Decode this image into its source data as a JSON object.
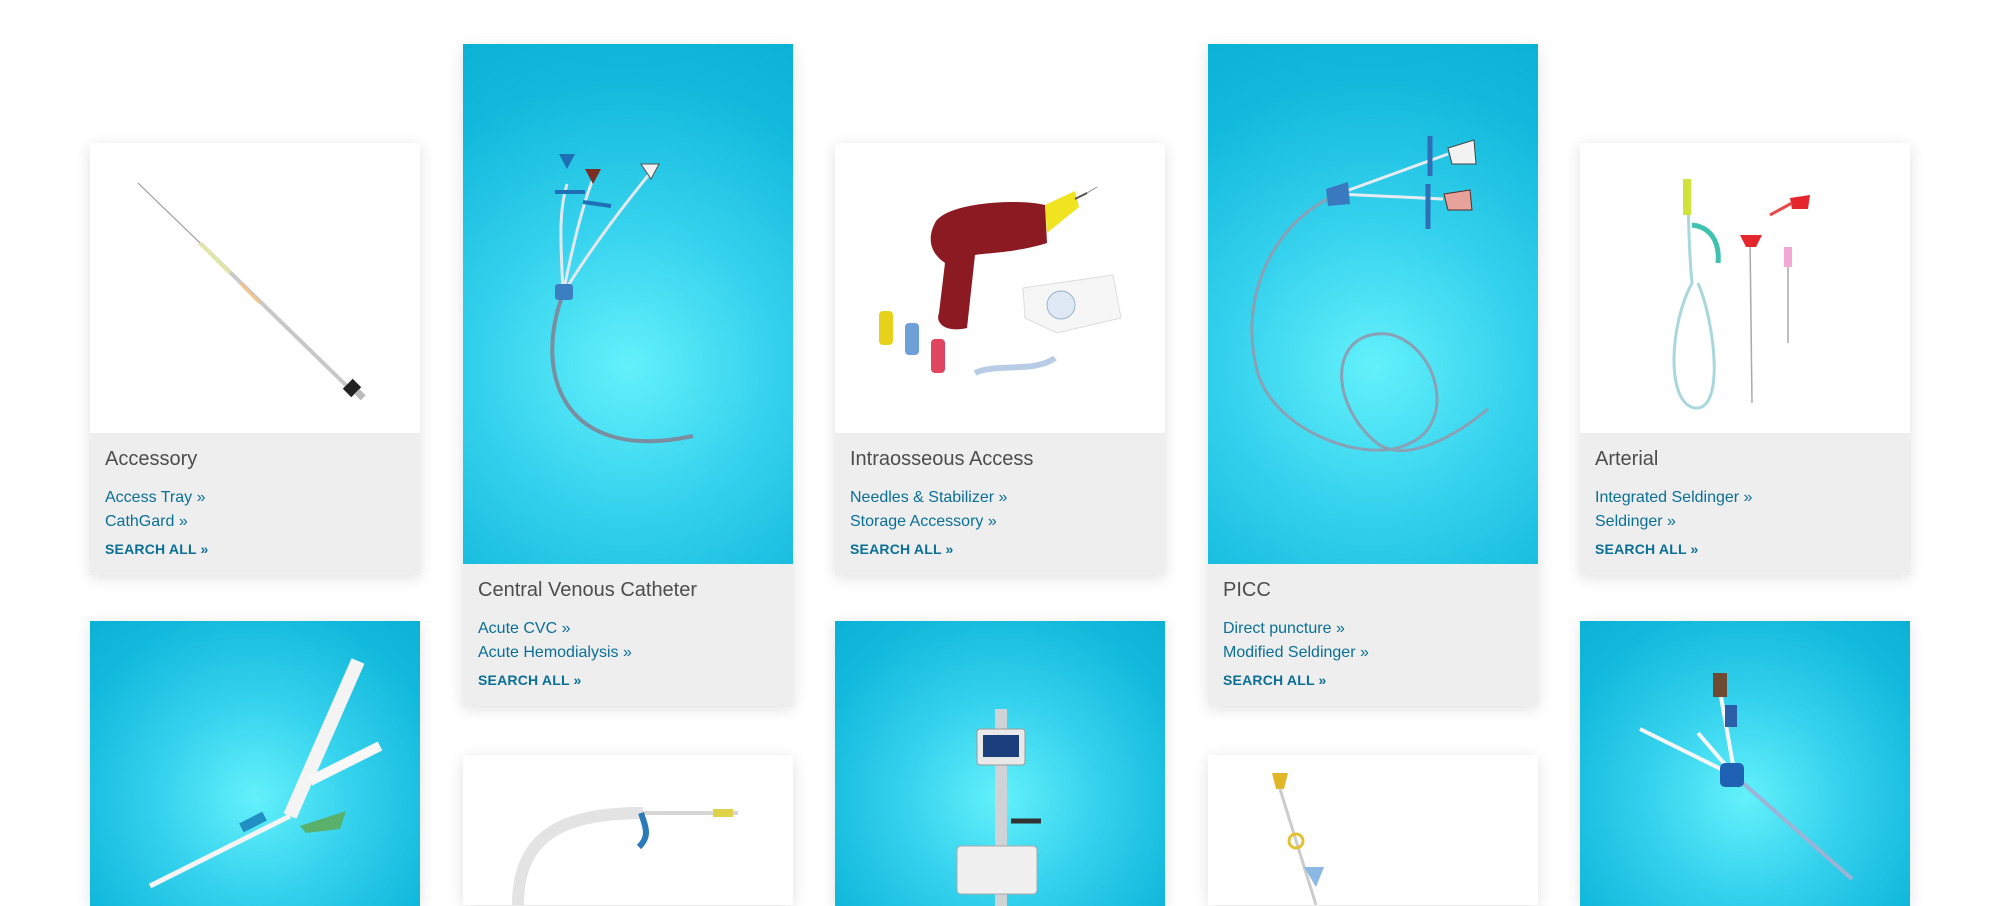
{
  "categories": [
    {
      "title": "Accessory",
      "links": [
        "Access Tray »",
        "CathGard »"
      ],
      "search_all": "SEARCH ALL »",
      "image": "needle-product-image"
    },
    {
      "title": "Central Venous Catheter",
      "links": [
        "Acute CVC »",
        "Acute Hemodialysis »"
      ],
      "search_all": "SEARCH ALL »",
      "image": "triple-lumen-catheter-image"
    },
    {
      "title": "Intraosseous Access",
      "links": [
        "Needles & Stabilizer »",
        "Storage Accessory »"
      ],
      "search_all": "SEARCH ALL »",
      "image": "intraosseous-driver-image"
    },
    {
      "title": "PICC",
      "links": [
        "Direct puncture »",
        "Modified Seldinger »"
      ],
      "search_all": "SEARCH ALL »",
      "image": "picc-catheter-image"
    },
    {
      "title": "Arterial",
      "links": [
        "Integrated Seldinger »",
        "Seldinger »"
      ],
      "search_all": "SEARCH ALL »",
      "image": "arterial-line-image"
    }
  ],
  "colors": {
    "link": "#0a6f95",
    "title": "#4d4d4d",
    "card_bg": "#eeeeee",
    "blue_bg": "#13b9dc"
  }
}
